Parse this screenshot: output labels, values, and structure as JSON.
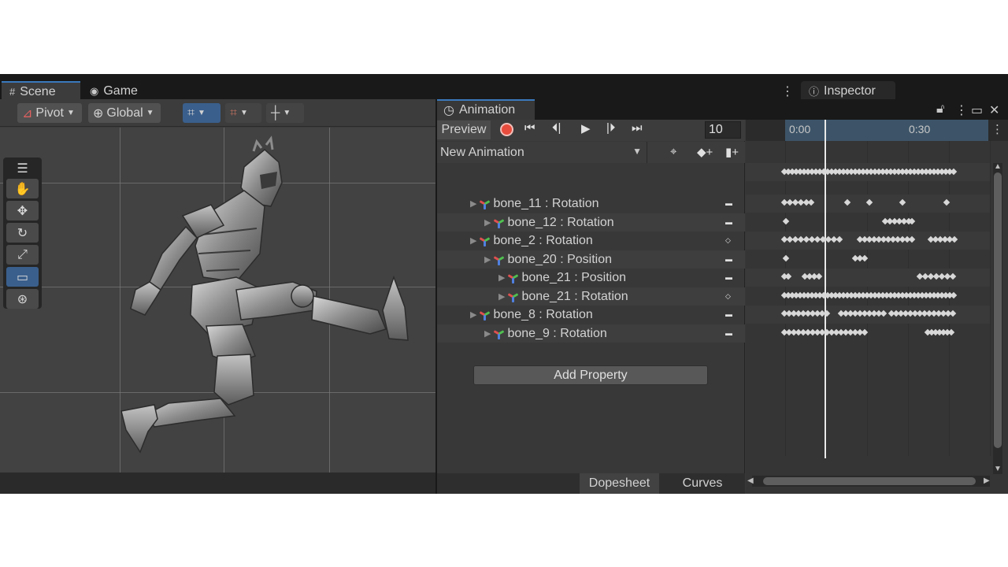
{
  "tabs": {
    "scene": "Scene",
    "game": "Game",
    "inspector": "Inspector"
  },
  "scene_toolbar": {
    "pivot": "Pivot",
    "global": "Global"
  },
  "animation": {
    "tab": "Animation",
    "preview": "Preview",
    "frame": "10",
    "clip": "New Animation",
    "timeline_labels": [
      "0:00",
      "0:30"
    ],
    "properties": [
      {
        "label": "bone_11 : Rotation",
        "indent": 0
      },
      {
        "label": "bone_12 : Rotation",
        "indent": 1
      },
      {
        "label": "bone_2 : Rotation",
        "indent": 0
      },
      {
        "label": "bone_20 : Position",
        "indent": 1
      },
      {
        "label": "bone_21 : Position",
        "indent": 2
      },
      {
        "label": "bone_21 : Rotation",
        "indent": 2
      },
      {
        "label": "bone_8 : Rotation",
        "indent": 0
      },
      {
        "label": "bone_9 : Rotation",
        "indent": 1
      }
    ],
    "add_property": "Add Property",
    "bottom_tabs": {
      "dopesheet": "Dopesheet",
      "curves": "Curves"
    }
  },
  "icons": {
    "scene_tab": "grid-icon",
    "game_tab": "gamepad-icon",
    "inspector_tab": "info-icon",
    "animation_tab": "clock-icon",
    "record": "record-icon",
    "first_key": "first-key-icon",
    "prev_key": "prev-key-icon",
    "play": "play-icon",
    "next_key": "next-key-icon",
    "last_key": "last-key-icon",
    "add_keyframe": "add-keyframe-icon",
    "add_event": "add-event-icon",
    "lock": "lock-icon",
    "maximize": "maximize-icon",
    "close": "close-icon"
  },
  "colors": {
    "accent": "#3a79bb",
    "record": "#e74c3c",
    "panel": "#383838"
  }
}
